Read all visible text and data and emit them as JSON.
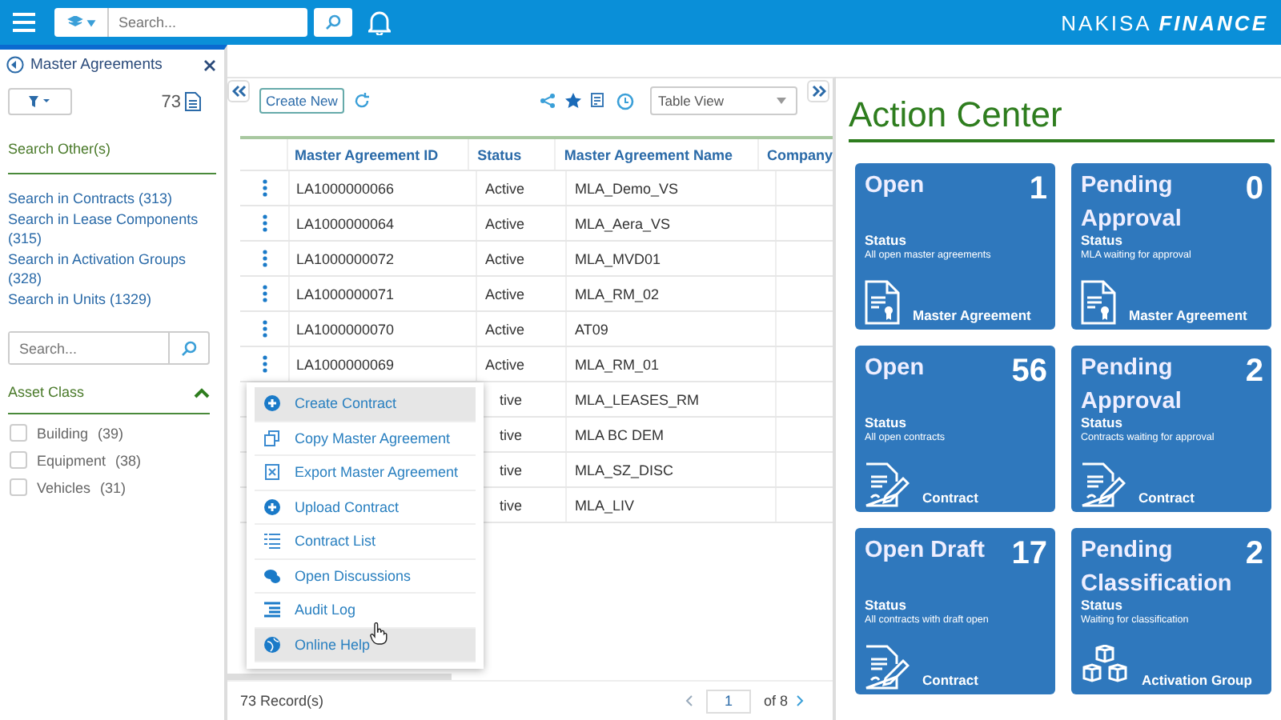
{
  "topbar": {
    "search": {
      "placeholder": "Search..."
    },
    "brand": "NAKISA",
    "brand_suffix": "FINANCE"
  },
  "sidebar": {
    "title": "Master Agreements",
    "count": "73",
    "search_other": "Search Other(s)",
    "links": [
      "Search in Contracts (313)",
      "Search in Lease Components (315)",
      "Search in Activation Groups (328)",
      "Search in Units (1329)"
    ],
    "search": {
      "placeholder": "Search..."
    },
    "asset_class": {
      "title": "Asset Class",
      "expanded": true,
      "filters": [
        {
          "label": "Building",
          "count": "(39)",
          "checked": false
        },
        {
          "label": "Equipment",
          "count": "(38)",
          "checked": false
        },
        {
          "label": "Vehicles",
          "count": "(31)",
          "checked": false
        }
      ]
    }
  },
  "toolbar": {
    "create_new": "Create New",
    "view": "Table View"
  },
  "table": {
    "columns": [
      "Master Agreement ID",
      "Status",
      "Master Agreement Name",
      "Company"
    ],
    "rows": [
      {
        "id": "LA1000000066",
        "status": "Active",
        "name": "MLA_Demo_VS",
        "covered": false
      },
      {
        "id": "LA1000000064",
        "status": "Active",
        "name": "MLA_Aera_VS",
        "covered": false
      },
      {
        "id": "LA1000000072",
        "status": "Active",
        "name": "MLA_MVD01",
        "covered": false
      },
      {
        "id": "LA1000000071",
        "status": "Active",
        "name": "MLA_RM_02",
        "covered": false
      },
      {
        "id": "LA1000000070",
        "status": "Active",
        "name": "AT09",
        "covered": false
      },
      {
        "id": "LA1000000069",
        "status": "Active",
        "name": "MLA_RM_01",
        "covered": false
      },
      {
        "status": "tive",
        "name": "MLA_LEASES_RM",
        "covered": true
      },
      {
        "status": "tive",
        "name": "MLA BC DEM",
        "covered": true
      },
      {
        "status": "tive",
        "name": "MLA_SZ_DISC",
        "covered": true
      },
      {
        "status": "tive",
        "name": "MLA_LIV",
        "covered": true
      }
    ]
  },
  "context_menu": [
    {
      "label": "Create Contract",
      "kind": "plus",
      "selected": true
    },
    {
      "label": "Copy Master Agreement",
      "kind": "copy",
      "selected": false
    },
    {
      "label": "Export Master Agreement",
      "kind": "export",
      "selected": false
    },
    {
      "label": "Upload Contract",
      "kind": "plus",
      "selected": false
    },
    {
      "label": "Contract List",
      "kind": "list",
      "selected": false
    },
    {
      "label": "Open Discussions",
      "kind": "chat",
      "selected": false
    },
    {
      "label": "Audit Log",
      "kind": "log",
      "selected": false
    },
    {
      "label": "Online Help",
      "kind": "globe",
      "selected": true
    }
  ],
  "footer": {
    "records": "73 Record(s)",
    "page": "1",
    "of": "of 8"
  },
  "action_center": {
    "title": "Action Center",
    "cards": [
      {
        "title": "Open",
        "count": "1",
        "status_label": "Status",
        "description": "All open master agreements",
        "type": "Master Agreement",
        "kind": "document"
      },
      {
        "title": "Pending Approval",
        "count": "0",
        "status_label": "Status",
        "description": "MLA waiting for approval",
        "type": "Master Agreement",
        "kind": "document"
      },
      {
        "title": "Open",
        "count": "56",
        "status_label": "Status",
        "description": "All open contracts",
        "type": "Contract",
        "kind": "pen"
      },
      {
        "title": "Pending Approval",
        "count": "2",
        "status_label": "Status",
        "description": "Contracts waiting for approval",
        "type": "Contract",
        "kind": "pen"
      },
      {
        "title": "Open Draft",
        "count": "17",
        "status_label": "Status",
        "description": "All contracts with draft open",
        "type": "Contract",
        "kind": "pen"
      },
      {
        "title": "Pending Classification",
        "count": "2",
        "status_label": "Status",
        "description": "Waiting for classification",
        "type": "Activation Group",
        "kind": "cubes"
      }
    ]
  }
}
